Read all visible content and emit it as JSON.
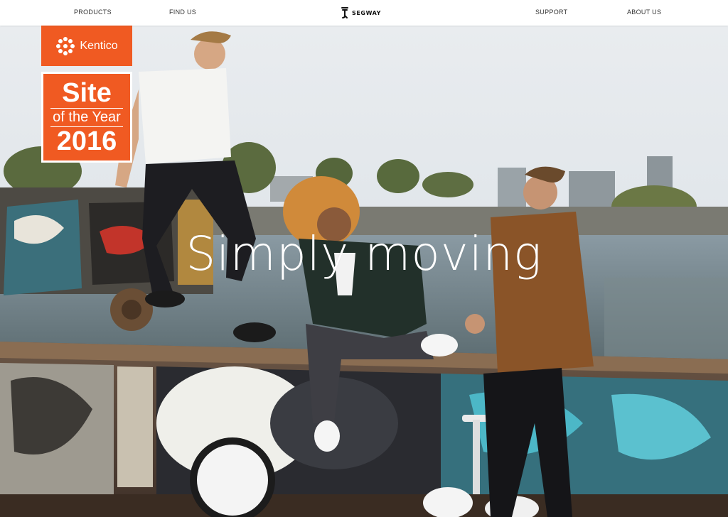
{
  "nav": {
    "products": "PRODUCTS",
    "find_us": "FIND US",
    "logo_text": "SEGWAY",
    "support": "SUPPORT",
    "about_us": "ABOUT US"
  },
  "hero": {
    "headline": "Simply moving"
  },
  "badge": {
    "brand": "Kentico",
    "site": "Site",
    "of_the_year": "of the Year",
    "year": "2016",
    "color": "#f05a22"
  }
}
